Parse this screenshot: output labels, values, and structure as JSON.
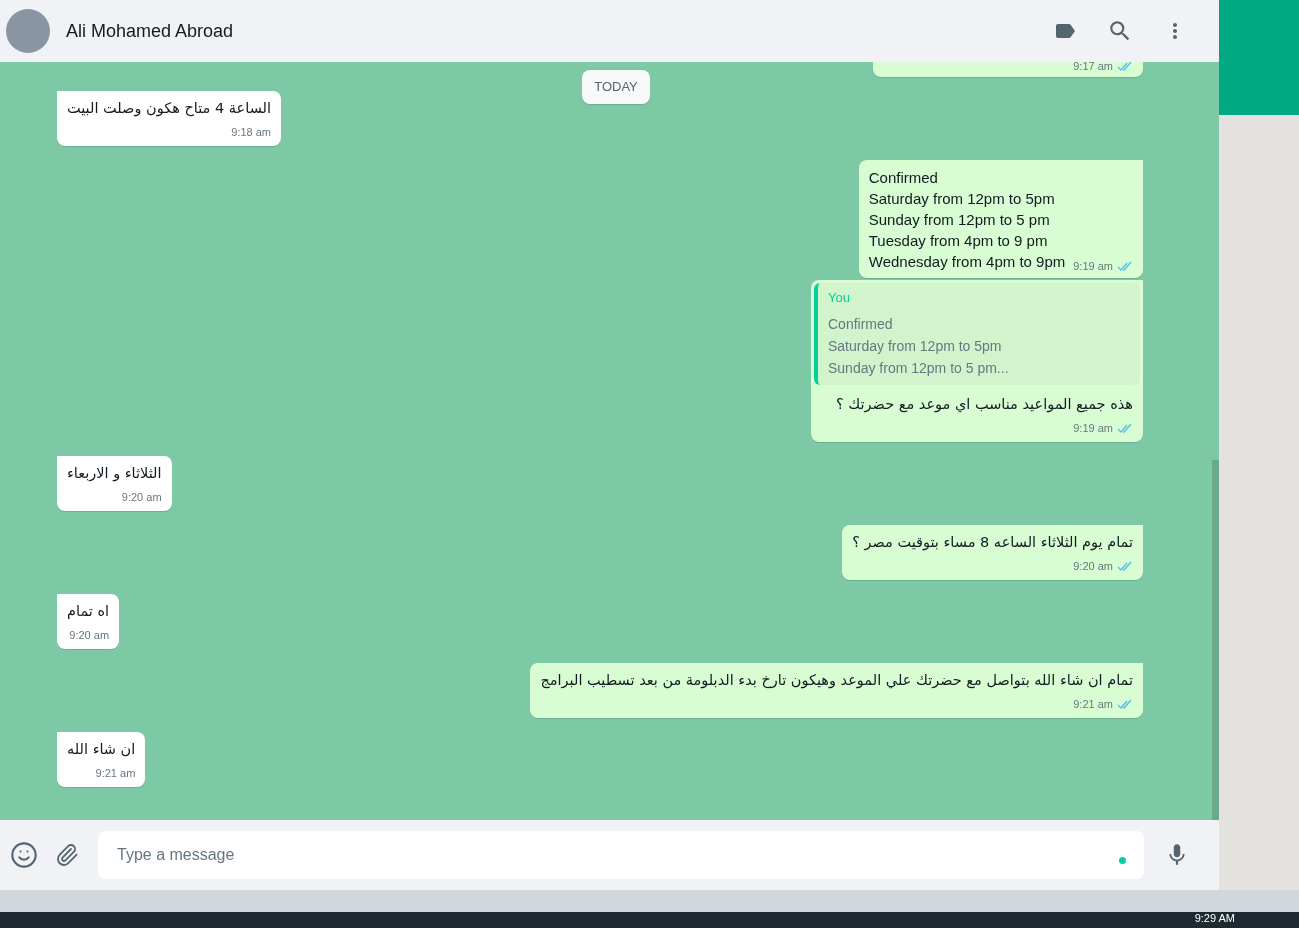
{
  "header": {
    "contact_name": "Ali Mohamed Abroad"
  },
  "messages": [
    {
      "kind": "partial",
      "outgoing": true,
      "time": "9:17 am",
      "read": true
    },
    {
      "kind": "date",
      "label": "TODAY"
    },
    {
      "kind": "text",
      "outgoing": false,
      "rtl": true,
      "text": "الساعة 4 متاح هكون وصلت البيت",
      "time": "9:18 am"
    },
    {
      "kind": "text",
      "outgoing": true,
      "rtl": false,
      "text": "Confirmed\nSaturday from 12pm to 5pm\nSunday from 12pm to 5 pm\nTuesday from 4pm to 9 pm\nWednesday from 4pm to 9pm",
      "time": "9:19 am",
      "read": true
    },
    {
      "kind": "reply",
      "outgoing": true,
      "rtl": true,
      "quote": {
        "author": "You",
        "lines": [
          "Confirmed",
          "Saturday from 12pm to 5pm",
          "Sunday from 12pm to 5 pm..."
        ]
      },
      "text": "هذه جميع المواعيد مناسب اي موعد مع حضرتك ؟",
      "time": "9:19 am",
      "read": true
    },
    {
      "kind": "text",
      "outgoing": false,
      "rtl": true,
      "text": "الثلاثاء و الاربعاء",
      "time": "9:20 am"
    },
    {
      "kind": "text",
      "outgoing": true,
      "rtl": true,
      "text": "تمام يوم الثلاثاء  الساعه 8 مساء بتوقيت مصر ؟",
      "time": "9:20 am",
      "read": true
    },
    {
      "kind": "text",
      "outgoing": false,
      "rtl": true,
      "text": "اه تمام",
      "time": "9:20 am"
    },
    {
      "kind": "text",
      "outgoing": true,
      "rtl": true,
      "text": "تمام ان شاء الله بتواصل مع حضرتك علي الموعد وهيكون تارخ بدء الدبلومة من بعد تسطيب البرامج",
      "time": "9:21 am",
      "read": true
    },
    {
      "kind": "text",
      "outgoing": false,
      "rtl": true,
      "text": "ان شاء الله",
      "time": "9:21 am"
    }
  ],
  "composer": {
    "placeholder": "Type a message"
  },
  "taskbar": {
    "clock": "9:29 AM"
  }
}
